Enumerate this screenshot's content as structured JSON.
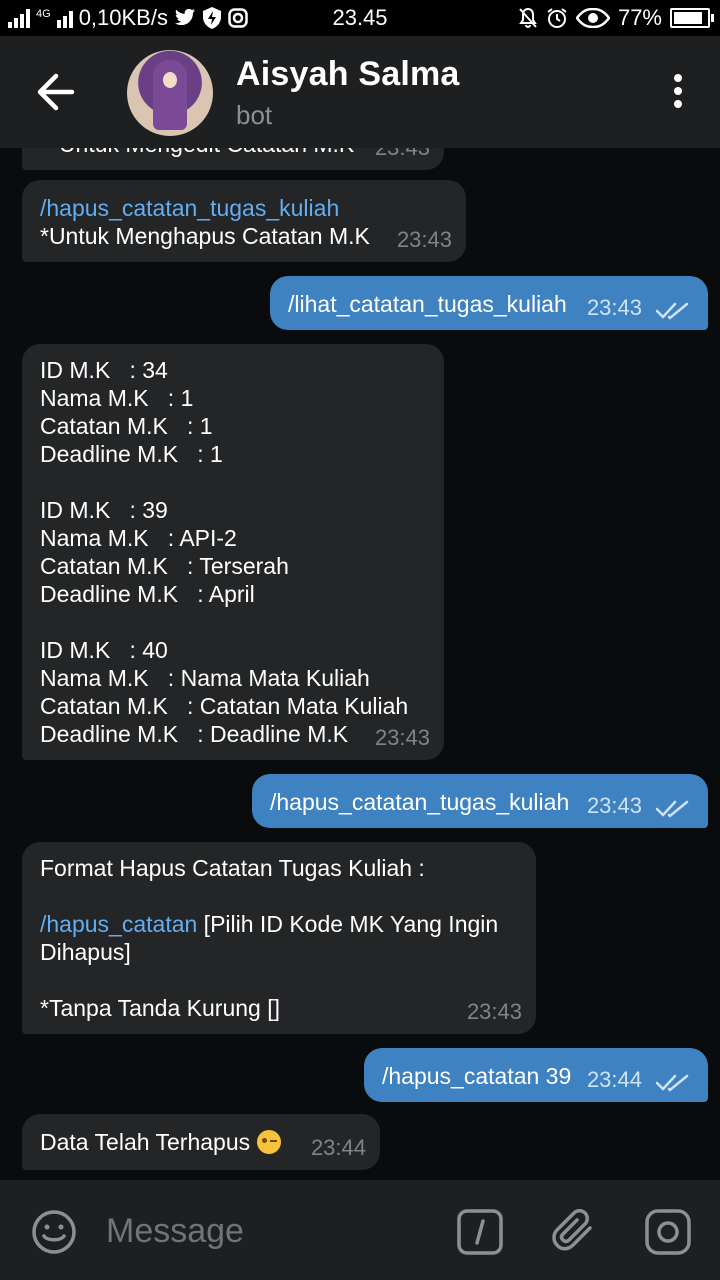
{
  "status_bar": {
    "network_type": "4G",
    "speed": "0,10KB/s",
    "time": "23.45",
    "battery": "77%",
    "battery_level": 0.77
  },
  "header": {
    "name": "Aisyah Salma",
    "subtitle": "bot"
  },
  "messages": [
    {
      "direction": "in",
      "partial": true,
      "text": "*Untuk Mengedit Catatan M.K",
      "time": "23:43"
    },
    {
      "direction": "in",
      "command": "/hapus_catatan_tugas_kuliah",
      "text": "*Untuk Menghapus Catatan M.K",
      "time": "23:43"
    },
    {
      "direction": "out",
      "command": "/lihat_catatan_tugas_kuliah",
      "time": "23:43",
      "read": true
    },
    {
      "direction": "in",
      "text": "ID M.K   : 34\nNama M.K   : 1\nCatatan M.K   : 1\nDeadline M.K   : 1\n\nID M.K   : 39\nNama M.K   : API-2\nCatatan M.K   : Terserah\nDeadline M.K   : April\n\nID M.K   : 40\nNama M.K   : Nama Mata Kuliah\nCatatan M.K   : Catatan Mata Kuliah\nDeadline M.K   : Deadline M.K",
      "time": "23:43"
    },
    {
      "direction": "out",
      "command": "/hapus_catatan_tugas_kuliah",
      "time": "23:43",
      "read": true
    },
    {
      "direction": "in",
      "line1": "Format Hapus Catatan Tugas Kuliah :",
      "command": "/hapus_catatan",
      "after_command": " [Pilih ID Kode MK Yang Ingin Dihapus]",
      "note": "*Tanpa Tanda Kurung []",
      "time": "23:43"
    },
    {
      "direction": "out",
      "command": "/hapus_catatan",
      "arg": " 39",
      "time": "23:44",
      "read": true
    },
    {
      "direction": "in",
      "text": "Data Telah Terhapus",
      "emoji": "winking-face",
      "time": "23:44"
    }
  ],
  "input": {
    "placeholder": "Message"
  },
  "colors": {
    "background": "#0a0b0c",
    "header": "#1d1f21",
    "incoming_bubble": "#232527",
    "outgoing_bubble": "#3e82c1",
    "link": "#62aef2"
  }
}
